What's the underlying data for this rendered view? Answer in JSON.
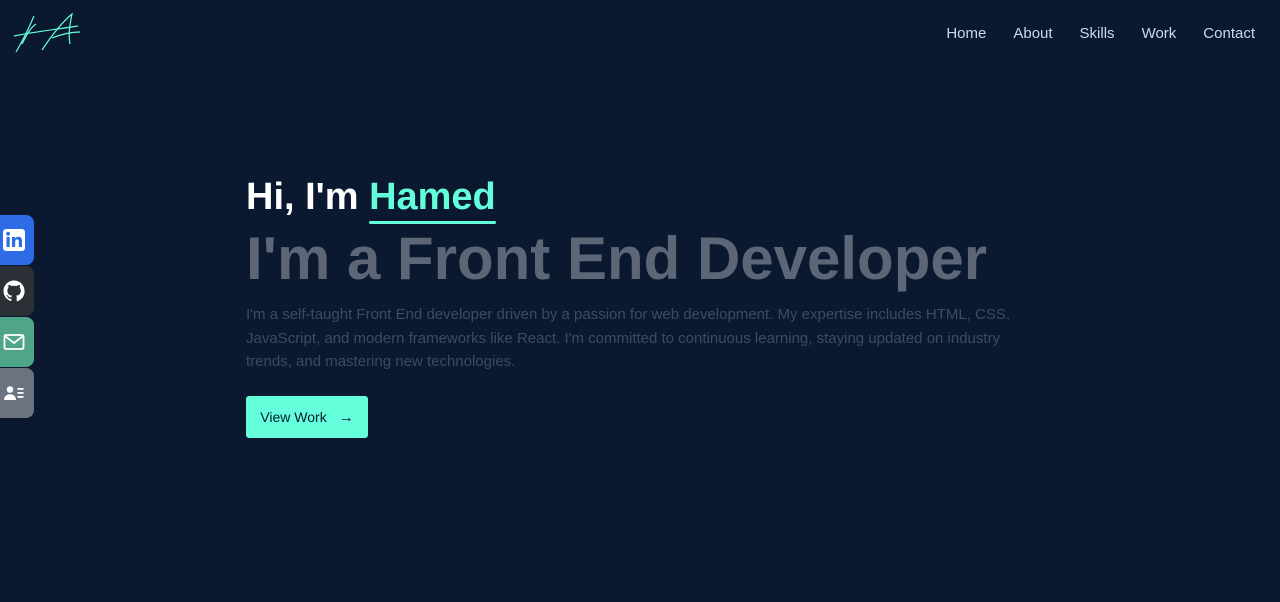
{
  "logo": {
    "text": "HA"
  },
  "nav": {
    "items": [
      {
        "label": "Home"
      },
      {
        "label": "About"
      },
      {
        "label": "Skills"
      },
      {
        "label": "Work"
      },
      {
        "label": "Contact"
      }
    ]
  },
  "social": [
    {
      "name": "linkedin-icon",
      "color": "#2e6be6"
    },
    {
      "name": "github-icon",
      "color": "#2b2f36"
    },
    {
      "name": "mail-icon",
      "color": "#4fa58a"
    },
    {
      "name": "contact-card-icon",
      "color": "#6b7380"
    }
  ],
  "hero": {
    "greeting": "Hi, I'm",
    "name": "Hamed",
    "role": "I'm a Front End Developer",
    "intro": "I'm a self-taught Front End developer driven by a passion for web development. My expertise includes HTML, CSS, JavaScript, and modern frameworks like React. I'm committed to continuous learning, staying updated on industry trends, and mastering new technologies.",
    "cta_label": "View Work",
    "cta_arrow": "→"
  },
  "colors": {
    "background": "#0a192f",
    "accent": "#64ffda",
    "nav_text": "#ccd6f6",
    "role_text": "#5c6677",
    "intro_text": "#3d4b5f"
  }
}
